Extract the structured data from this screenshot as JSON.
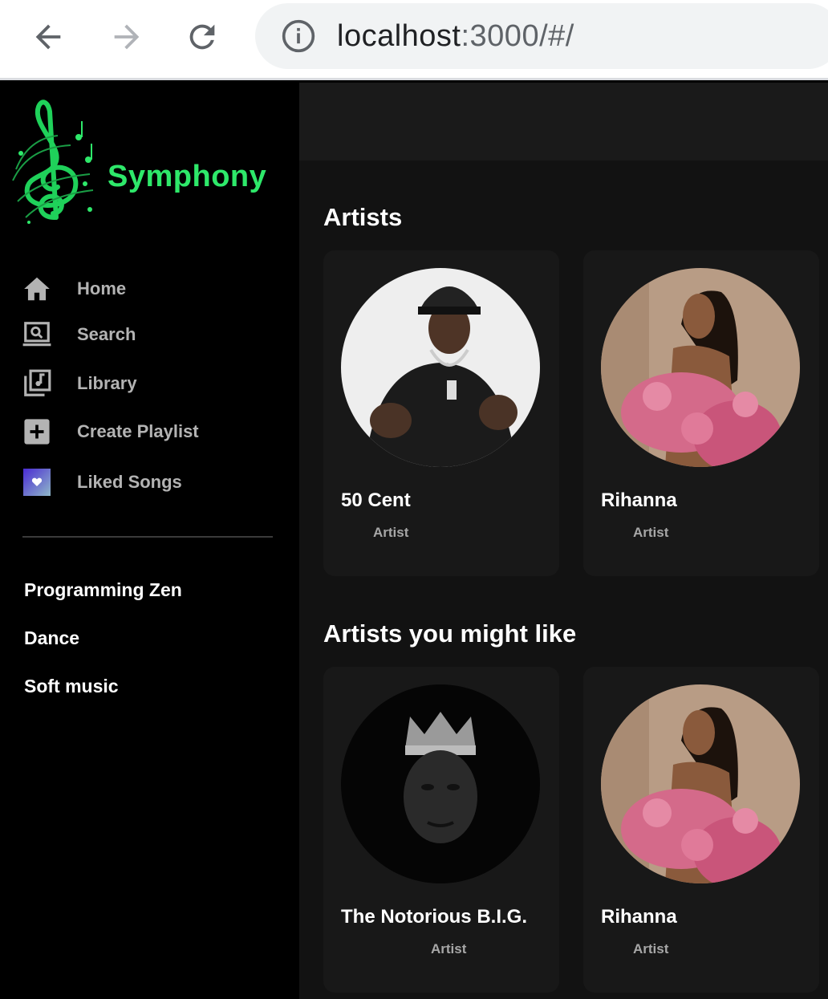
{
  "browser": {
    "url_host": "localhost",
    "url_rest": ":3000/#/"
  },
  "app": {
    "brand": "Symphony",
    "accent": "#2ee86a"
  },
  "nav": [
    {
      "label": "Home",
      "icon": "home-icon"
    },
    {
      "label": "Search",
      "icon": "search-icon"
    },
    {
      "label": "Library",
      "icon": "library-icon"
    },
    {
      "label": "Create Playlist",
      "icon": "plus-icon"
    },
    {
      "label": "Liked Songs",
      "icon": "heart-icon"
    }
  ],
  "playlists": [
    "Programming Zen",
    "Dance",
    "Soft music"
  ],
  "sections": [
    {
      "title": "Artists",
      "cards": [
        {
          "name": "50 Cent",
          "subtitle": "Artist"
        },
        {
          "name": "Rihanna",
          "subtitle": "Artist"
        }
      ]
    },
    {
      "title": "Artists you might like",
      "cards": [
        {
          "name": "The Notorious B.I.G.",
          "subtitle": "Artist"
        },
        {
          "name": "Rihanna",
          "subtitle": "Artist"
        }
      ]
    }
  ]
}
